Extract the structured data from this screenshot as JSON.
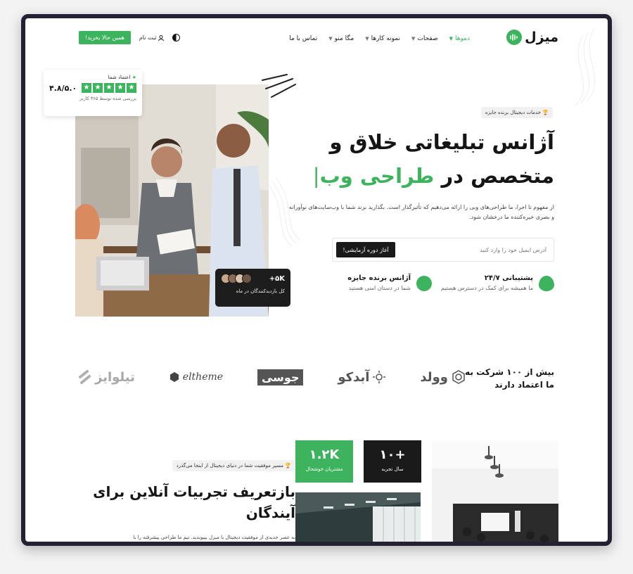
{
  "brand": {
    "name": "میزل",
    "accent": "#3eb35d",
    "dark": "#1a1a1a"
  },
  "nav": {
    "items": [
      {
        "label": "دموها",
        "active": true,
        "has_dropdown": true
      },
      {
        "label": "صفحات",
        "active": false,
        "has_dropdown": true
      },
      {
        "label": "نمونه کارها",
        "active": false,
        "has_dropdown": true
      },
      {
        "label": "مگا منو",
        "active": false,
        "has_dropdown": true
      },
      {
        "label": "تماس با ما",
        "active": false,
        "has_dropdown": false
      }
    ],
    "buy_label": "همین حالا بخرید!",
    "signup_label": "ثبت نام",
    "icons": {
      "signup": "user-icon",
      "theme": "theme-toggle-icon"
    }
  },
  "hero": {
    "badge": "خدمات دیجیتال برنده جایزه",
    "title_line1": "آژانس تبلیغاتی خلاق و",
    "title_line2_prefix": "متخصص در",
    "title_line2_highlight": "طراحی وب",
    "caret": "|",
    "description": "از مفهوم تا اجرا، ما طراحی‌های وبی را ارائه می‌دهیم که تأثیرگذار است. بگذارید برند شما با وب‌سایت‌های نوآورانه و بصری خیره‌کننده ما درخشان شود.",
    "email_placeholder": "آدرس ایمیل خود را وارد کنید",
    "cta_label": "آغاز دوره آزمایشی!",
    "features": [
      {
        "title": "پشتیبانی ۲۴/۷",
        "subtitle": "ما همیشه برای کمک در دسترس هستیم",
        "icon": "support-leaf-icon"
      },
      {
        "title": "آژانس برنده جایزه",
        "subtitle": "شما در دستان امنی هستید",
        "icon": "award-icon"
      }
    ]
  },
  "rating_card": {
    "label": "اعتماد شما",
    "value": "۴.۸/۵.۰",
    "stars": 5,
    "note": "بررسی شده توسط ۳۶۵ کاربر"
  },
  "visitors_card": {
    "count": "+۵K",
    "label": "کل بازدیدکنندگان در ماه"
  },
  "trust": {
    "title": "بیش از ۱۰۰ شرکت به ما اعتماد دارند",
    "logos": [
      {
        "name": "تیلوایز",
        "icon": "tilwise-logo-icon"
      },
      {
        "name": "eltheme",
        "icon": "eltheme-logo-icon"
      },
      {
        "name": "جوسی",
        "icon": "joosy-logo-icon"
      },
      {
        "name": "آبدکو",
        "icon": "sun-logo-icon"
      },
      {
        "name": "وولد",
        "icon": "hexagon-logo-icon"
      }
    ]
  },
  "section2": {
    "badge": "مسیر موفقیت شما در دنیای دیجیتال از اینجا می‌گذرد",
    "title": "بازتعریف تجربیات آنلاین برای آیندگان",
    "description": "به عصر جدیدی از موفقیت دیجیتال با میزل بپیوندید. تیم ما طراحی پیشرفته را با",
    "stats": [
      {
        "value": "۱.۲K",
        "label": "مشتریان خوشحال"
      },
      {
        "value": "+۱۰",
        "label": "سال تجربه"
      }
    ]
  }
}
